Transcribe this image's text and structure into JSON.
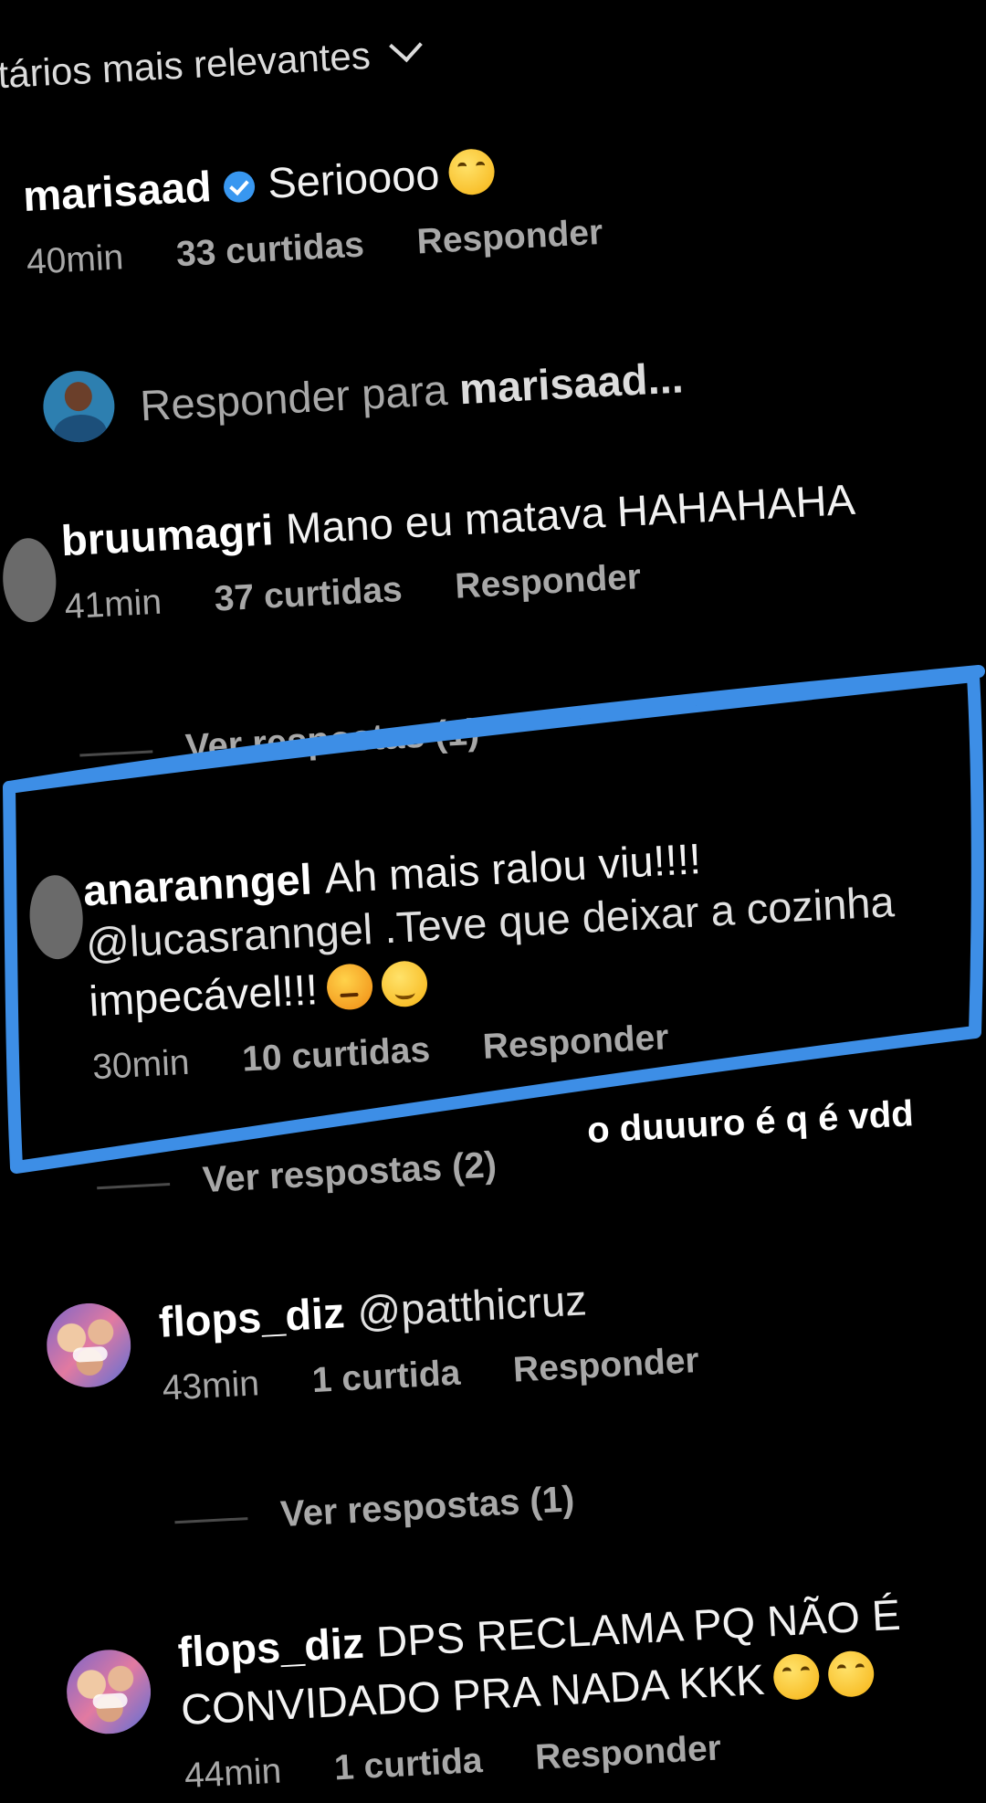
{
  "header": {
    "label": "ntários mais relevantes"
  },
  "reply_input": {
    "prefix": "Responder para",
    "target": "marisaad..."
  },
  "comments": [
    {
      "user": "marisaad",
      "verified": true,
      "text": "Serioooo",
      "time": "40min",
      "likes": "33 curtidas",
      "reply": "Responder"
    },
    {
      "user": "bruumagri",
      "text": "Mano eu matava HAHAHAHA",
      "time": "41min",
      "likes": "37 curtidas",
      "reply": "Responder",
      "view_replies": "Ver respostas (1)"
    },
    {
      "user": "anaranngel",
      "line1": "Ah mais ralou  viu!!!!",
      "line2": "@lucasranngel .Teve que deixar a cozinha",
      "line3": "impecável!!!",
      "time": "30min",
      "likes": "10 curtidas",
      "reply": "Responder",
      "view_replies": "Ver respostas (2)"
    },
    {
      "user": "flops_diz",
      "text": "@patthicruz",
      "time": "43min",
      "likes": "1 curtida",
      "reply": "Responder",
      "view_replies": "Ver respostas (1)"
    },
    {
      "user": "flops_diz",
      "line1": "DPS RECLAMA PQ NÃO É",
      "line2": "CONVIDADO PRA NADA KKK",
      "time": "44min",
      "likes": "1 curtida",
      "reply": "Responder"
    }
  ],
  "overlay": {
    "note": "o duuuro é q é vdd",
    "box_color": "#3d8ee6"
  },
  "icons": [
    "verified-badge-icon",
    "chevron-down-icon",
    "laughing-emoji-icon",
    "angry-emoji-icon",
    "blush-emoji-icon"
  ]
}
